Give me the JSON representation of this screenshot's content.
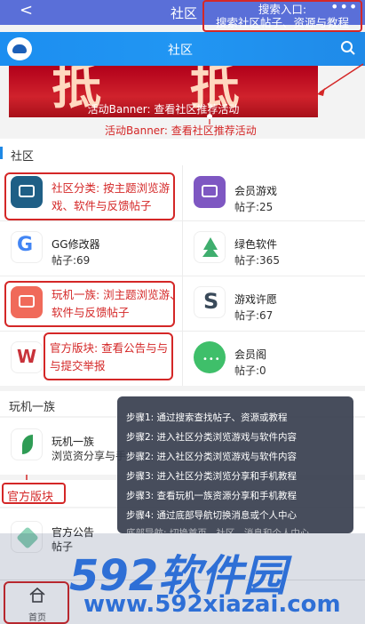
{
  "topbar": {
    "back": "<",
    "title": "社区",
    "more": "•••"
  },
  "callout_search": {
    "line1": "搜索入口:",
    "line2": "搜索社区帖子、资源与教程"
  },
  "header": {
    "title": "社区"
  },
  "banner": {
    "big": "抵 抵",
    "caption": "活动Banner: 查看社区推荐活动",
    "note": "活动Banner: 查看社区推荐活动"
  },
  "sections": {
    "community": "社区",
    "wanji": "玩机一族",
    "official": "官方版块"
  },
  "grid": [
    {
      "name": "",
      "count": "",
      "color": "#1f5f86"
    },
    {
      "name": "会员游戏",
      "count": "帖子:25",
      "color": "#7e57c2"
    },
    {
      "name": "GG修改器",
      "count": "帖子:69",
      "color": "#ffffff"
    },
    {
      "name": "绿色软件",
      "count": "帖子:365",
      "color": "#ffffff"
    },
    {
      "name": "",
      "count": "",
      "color": "#f06a5a"
    },
    {
      "name": "游戏许愿",
      "count": "帖子:67",
      "color": "#ffffff"
    },
    {
      "name": "",
      "count": "",
      "color": "#ffffff"
    },
    {
      "name": "会员阁",
      "count": "帖子:0",
      "color": "#3fbf6a"
    }
  ],
  "annotations": {
    "category": [
      "社区分类: 按主题浏览游",
      "戏、软件与反馈帖子"
    ],
    "wanji": [
      "玩机一族: 浏主题浏览游、",
      "软件与反馈帖子"
    ],
    "official": [
      "官方版块: 查看公告与与",
      "与提交举报"
    ]
  },
  "wanji_item": {
    "name": "玩机一族",
    "desc": "浏览资分享与手"
  },
  "official_item": {
    "name": "官方公告",
    "count": "帖子"
  },
  "steps": [
    "步骤1: 通过搜索查找帖子、资源或教程",
    "步骤2: 进入社区分类浏览游戏与软件内容",
    "步骤2: 进入社区分类浏览游戏与软件内容",
    "步骤3: 进入社区分类浏览分享和手机教程",
    "步骤3: 查看玩机一族资源分享和手机教程",
    "步骤4: 通过底部导航切换消息或个人中心",
    "底部导航: 切换首页、社区、消息和个人中心"
  ],
  "watermark": {
    "big": "592软件园",
    "url": "www.592xiazai.com"
  },
  "bottomnav": {
    "home": "首页"
  }
}
